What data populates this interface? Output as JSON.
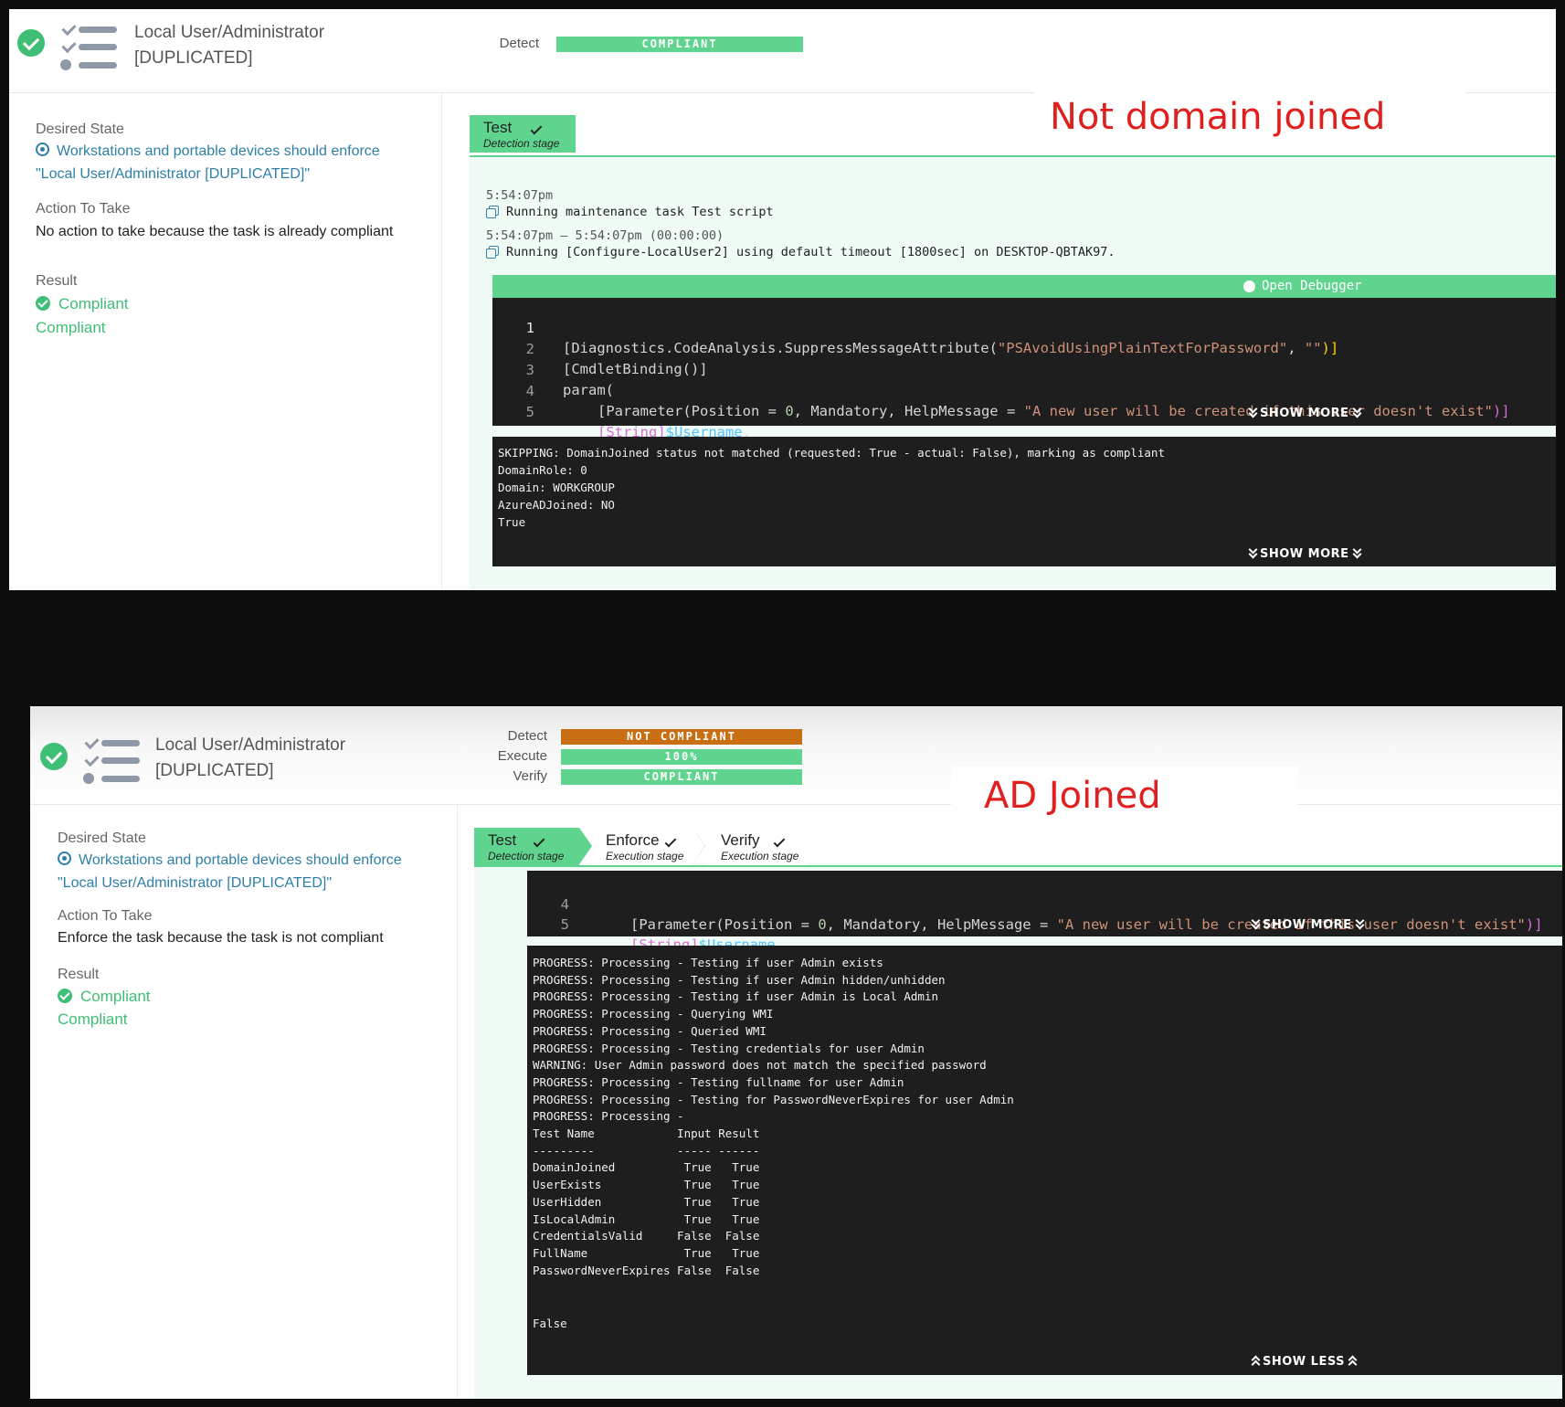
{
  "top": {
    "title_line1": "Local User/Administrator",
    "title_line2": "[DUPLICATED]",
    "status": [
      {
        "label": "Detect",
        "value": "COMPLIANT",
        "color": "#5fd48f"
      }
    ],
    "desired_state_label": "Desired State",
    "desired_state_line1": "Workstations and portable devices should enforce",
    "desired_state_line2": "\"Local User/Administrator [DUPLICATED]\"",
    "action_label": "Action To Take",
    "action_value": "No action to take because the task is already compliant",
    "result_label": "Result",
    "result_value1": "Compliant",
    "result_value2": "Compliant",
    "annotation": "Not domain joined",
    "tabs": [
      {
        "name": "Test",
        "sub": "Detection stage"
      }
    ],
    "log": {
      "time1": "5:54:07pm",
      "msg1": "Running maintenance task Test script",
      "time2": "5:54:07pm – 5:54:07pm (00:00:00)",
      "msg2": "Running [Configure-LocalUser2] using default timeout [1800sec] on DESKTOP-QBTAK97."
    },
    "debugger_label": "Open Debugger",
    "show_more_1": "SHOW MORE",
    "show_more_2": "SHOW MORE",
    "code_lines": [
      "1",
      "2",
      "3",
      "4",
      "5"
    ],
    "code": {
      "l1_a": "[Diagnostics.CodeAnalysis.SuppressMessageAttribute(",
      "l1_s1": "\"PSAvoidUsingPlainTextForPassword\"",
      "l1_c": ", ",
      "l1_s2": "\"\"",
      "l1_e": ")]",
      "l2": "[CmdletBinding()]",
      "l3": "param(",
      "l4_a": "[Parameter(Position = ",
      "l4_n": "0",
      "l4_b": ", Mandatory, HelpMessage = ",
      "l4_s": "\"A new user will be created if this user doesn't exist\"",
      "l4_e": ")]",
      "l5_a": "[String]",
      "l5_v": "$Username",
      "l5_e": ","
    },
    "output": [
      "SKIPPING: DomainJoined status not matched (requested: True - actual: False), marking as compliant",
      "DomainRole: 0",
      "Domain: WORKGROUP",
      "AzureADJoined: NO",
      "True"
    ]
  },
  "bottom": {
    "title_line1": "Local User/Administrator",
    "title_line2": "[DUPLICATED]",
    "status": [
      {
        "label": "Detect",
        "value": "NOT COMPLIANT",
        "color": "#c86f14"
      },
      {
        "label": "Execute",
        "value": "100%",
        "color": "#5fd48f"
      },
      {
        "label": "Verify",
        "value": "COMPLIANT",
        "color": "#5fd48f"
      }
    ],
    "desired_state_label": "Desired State",
    "desired_state_line1": "Workstations and portable devices should enforce",
    "desired_state_line2": "\"Local User/Administrator [DUPLICATED]\"",
    "action_label": "Action To Take",
    "action_value": "Enforce the task because the task is not compliant",
    "result_label": "Result",
    "result_value1": "Compliant",
    "result_value2": "Compliant",
    "annotation": "AD Joined",
    "tabs": [
      {
        "name": "Test",
        "sub": "Detection stage"
      },
      {
        "name": "Enforce",
        "sub": "Execution stage"
      },
      {
        "name": "Verify",
        "sub": "Execution stage"
      }
    ],
    "code_lines": [
      "4",
      "5"
    ],
    "show_more": "SHOW MORE",
    "show_less": "SHOW LESS",
    "output": [
      "PROGRESS: Processing - Testing if user Admin exists",
      "PROGRESS: Processing - Testing if user Admin hidden/unhidden",
      "PROGRESS: Processing - Testing if user Admin is Local Admin",
      "PROGRESS: Processing - Querying WMI",
      "PROGRESS: Processing - Queried WMI",
      "PROGRESS: Processing - Testing credentials for user Admin",
      "WARNING: User Admin password does not match the specified password",
      "PROGRESS: Processing - Testing fullname for user Admin",
      "PROGRESS: Processing - Testing for PasswordNeverExpires for user Admin",
      "PROGRESS: Processing -",
      "Test Name            Input Result",
      "---------            ----- ------",
      "DomainJoined          True   True",
      "UserExists            True   True",
      "UserHidden            True   True",
      "IsLocalAdmin          True   True",
      "CredentialsValid     False  False",
      "FullName              True   True",
      "PasswordNeverExpires False  False"
    ],
    "output_final": "False"
  }
}
